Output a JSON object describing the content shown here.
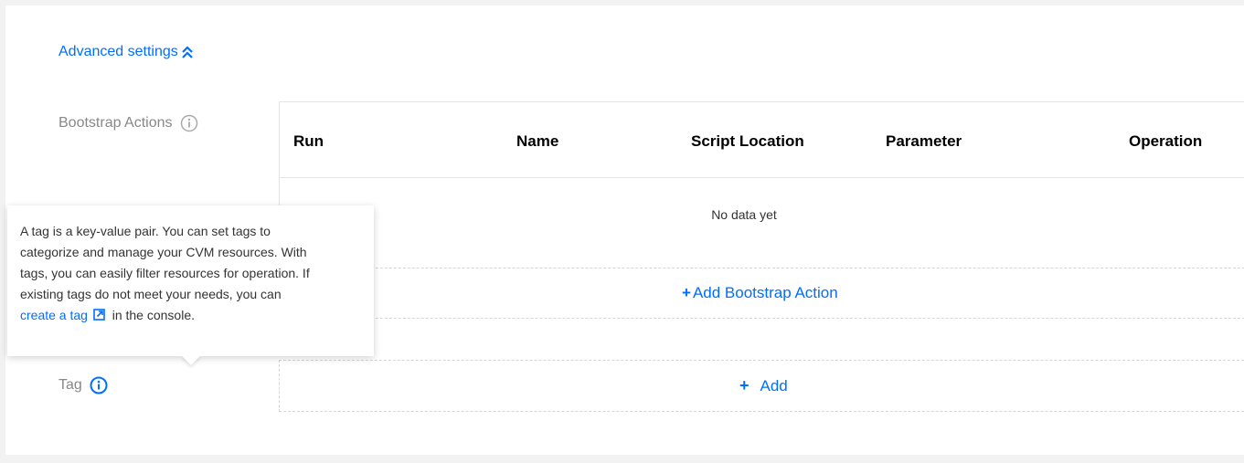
{
  "advanced": {
    "toggle_label": "Advanced settings",
    "toggle_icon": "chevron-double-up-icon"
  },
  "bootstrap": {
    "label": "Bootstrap Actions",
    "info_icon": "info-icon",
    "columns": [
      "Run",
      "Name",
      "Script Location",
      "Parameter",
      "Operation"
    ],
    "empty_text": "No data yet",
    "add_label": "Add Bootstrap Action"
  },
  "tag": {
    "label": "Tag",
    "info_icon": "info-icon",
    "add_label": "Add"
  },
  "tooltip": {
    "lines": [
      "A tag is a key-value pair. You can set tags to",
      "categorize and manage your CVM resources. With",
      "tags, you can easily filter resources for operation. If",
      "existing tags do not meet your needs, you can"
    ],
    "link_text": "create a tag",
    "link_icon": "external-link-icon",
    "suffix": "in the console."
  },
  "colors": {
    "accent": "#006eff",
    "label": "#888888",
    "border": "#e5e5e5"
  }
}
